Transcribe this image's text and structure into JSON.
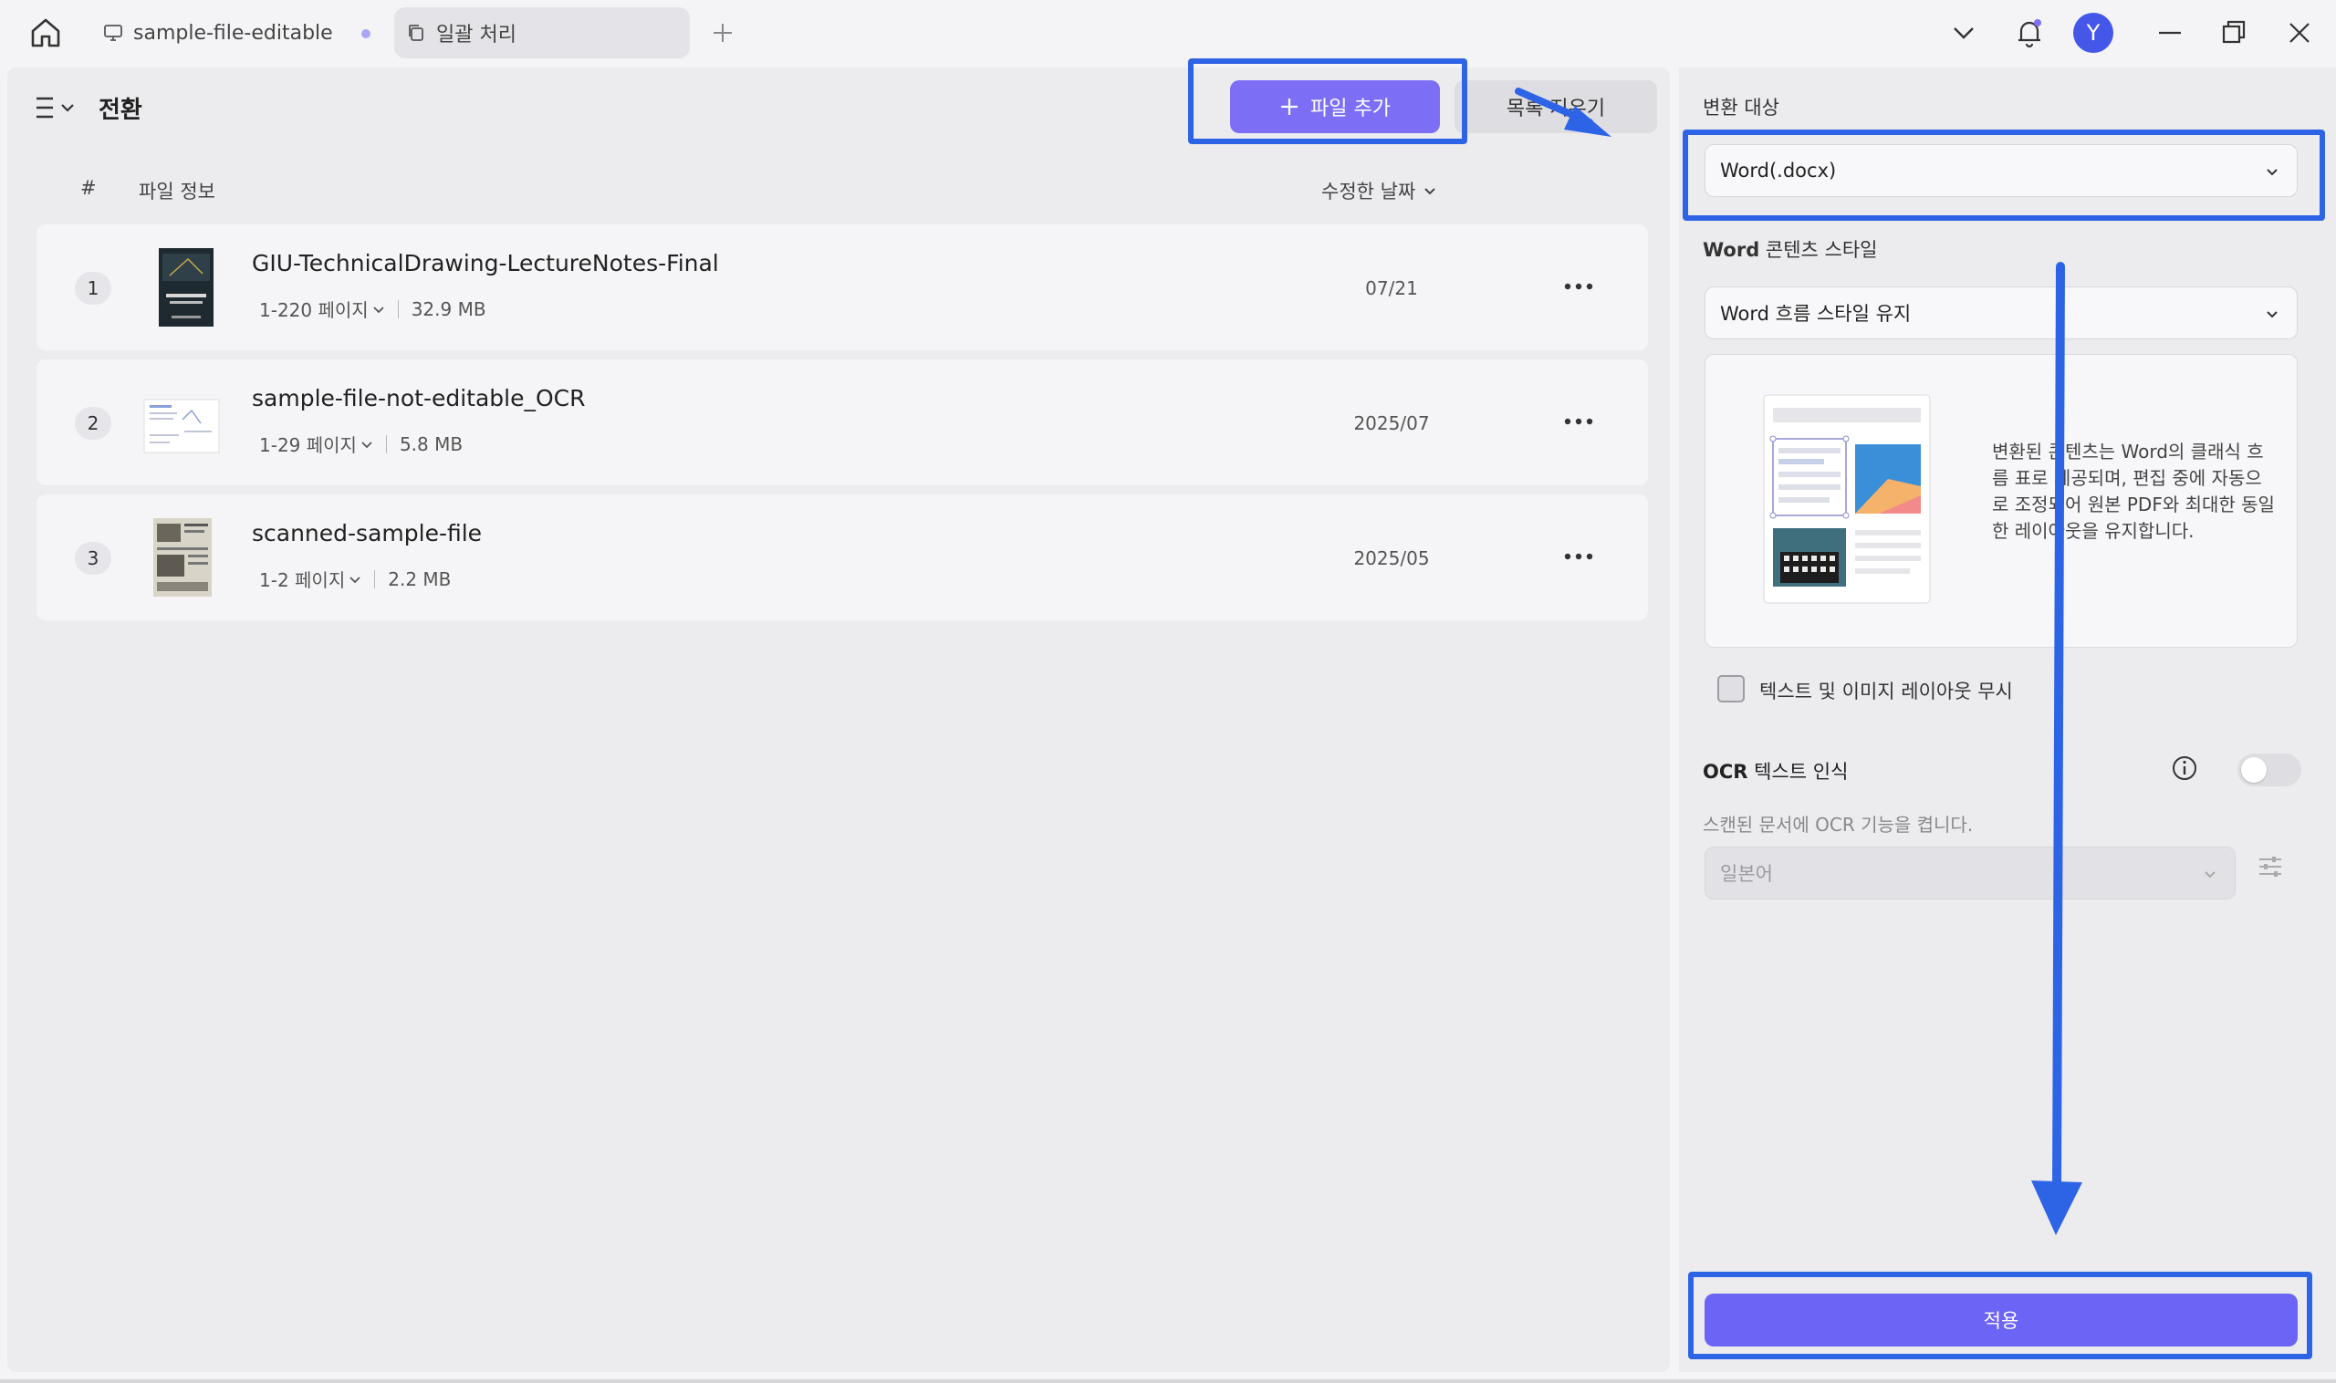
{
  "titlebar": {
    "tabs": [
      {
        "label": "sample-file-editable"
      },
      {
        "label": "일괄 처리"
      }
    ],
    "avatar_initial": "Y"
  },
  "main": {
    "title": "전환",
    "add_button": "파일 추가",
    "clear_button": "목록 지우기",
    "columns": {
      "num": "#",
      "info": "파일 정보",
      "date": "수정한 날짜"
    },
    "files": [
      {
        "num": "1",
        "name": "GIU-TechnicalDrawing-LectureNotes-Final",
        "pages": "1-220 페이지",
        "size": "32.9 MB",
        "date": "07/21"
      },
      {
        "num": "2",
        "name": "sample-file-not-editable_OCR",
        "pages": "1-29 페이지",
        "size": "5.8 MB",
        "date": "2025/07"
      },
      {
        "num": "3",
        "name": "scanned-sample-file",
        "pages": "1-2 페이지",
        "size": "2.2 MB",
        "date": "2025/05"
      }
    ]
  },
  "side": {
    "target_label": "변환 대상",
    "target_value": "Word(.docx)",
    "style_label_bold": "Word",
    "style_label_rest": " 콘텐츠 스타일",
    "style_value": "Word 흐름 스타일 유지",
    "preview_text": "변환된 콘텐츠는 Word의 클래식 흐름 표로 제공되며, 편집 중에 자동으로 조정되어 원본 PDF와 최대한 동일한 레이아웃을 유지합니다.",
    "checkbox_label": "텍스트 및 이미지 레이아웃 무시",
    "ocr_title_bold": "OCR",
    "ocr_title_rest": " 텍스트 인식",
    "ocr_desc": "스캔된 문서에 OCR 기능을 켭니다.",
    "ocr_language": "일본어",
    "ocr_enabled": false,
    "apply_button": "적용"
  },
  "colors": {
    "accent": "#7c6ff6",
    "apply": "#6c64f4",
    "annotation": "#2d64e6"
  }
}
